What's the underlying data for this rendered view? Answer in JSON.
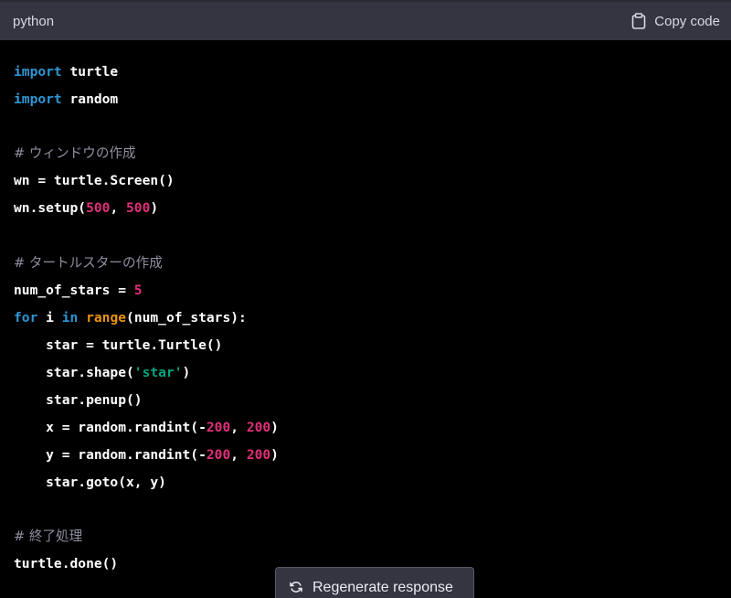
{
  "header": {
    "language": "python",
    "copy_label": "Copy code",
    "copy_icon": "clipboard-icon"
  },
  "code": {
    "l1_kw": "import",
    "l1_rest": " turtle",
    "l2_kw": "import",
    "l2_rest": " random",
    "l4_comment": "# ウィンドウの作成",
    "l5": "wn = turtle.Screen()",
    "l6_a": "wn.setup(",
    "l6_n1": "500",
    "l6_b": ", ",
    "l6_n2": "500",
    "l6_c": ")",
    "l8_comment": "# タートルスターの作成",
    "l9_a": "num_of_stars = ",
    "l9_n": "5",
    "l10_for": "for",
    "l10_a": " i ",
    "l10_in": "in",
    "l10_b": " ",
    "l10_range": "range",
    "l10_c": "(num_of_stars):",
    "l11": "    star = turtle.Turtle()",
    "l12_a": "    star.shape(",
    "l12_s": "'star'",
    "l12_b": ")",
    "l13": "    star.penup()",
    "l14_a": "    x = random.randint(-",
    "l14_n1": "200",
    "l14_b": ", ",
    "l14_n2": "200",
    "l14_c": ")",
    "l15_a": "    y = random.randint(-",
    "l15_n1": "200",
    "l15_b": ", ",
    "l15_n2": "200",
    "l15_c": ")",
    "l16": "    star.goto(x, y)",
    "l18_comment": "# 終了処理",
    "l19": "turtle.done()"
  },
  "footer": {
    "regenerate_label": "Regenerate response",
    "regenerate_icon": "refresh-icon"
  }
}
